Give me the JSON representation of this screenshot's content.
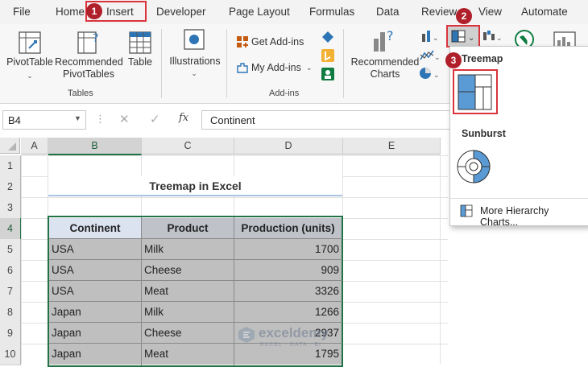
{
  "menu": {
    "tabs": [
      "File",
      "Home",
      "Insert",
      "Developer",
      "Page Layout",
      "Formulas",
      "Data",
      "Review",
      "View",
      "Automate"
    ]
  },
  "ribbon": {
    "pivot_table": "PivotTable",
    "recommended_pivot_1": "Recommended",
    "recommended_pivot_2": "PivotTables",
    "table": "Table",
    "group_tables": "Tables",
    "illustrations": "Illustrations",
    "get_addins": "Get Add-ins",
    "my_addins": "My Add-ins",
    "group_addins": "Add-ins",
    "recommended_charts_1": "Recommended",
    "recommended_charts_2": "Charts"
  },
  "formula_bar": {
    "name_box": "B4",
    "fx": "fx",
    "content": "Continent"
  },
  "grid": {
    "columns": [
      "A",
      "B",
      "C",
      "D",
      "E"
    ],
    "rows": [
      "1",
      "2",
      "3",
      "4",
      "5",
      "6",
      "7",
      "8",
      "9",
      "10"
    ],
    "title": "Treemap in Excel",
    "headers": [
      "Continent",
      "Product",
      "Production (units)"
    ],
    "data": [
      [
        "USA",
        "Milk",
        "1700"
      ],
      [
        "USA",
        "Cheese",
        "909"
      ],
      [
        "USA",
        "Meat",
        "3326"
      ],
      [
        "Japan",
        "Milk",
        "1266"
      ],
      [
        "Japan",
        "Cheese",
        "2937"
      ],
      [
        "Japan",
        "Meat",
        "1795"
      ]
    ]
  },
  "dropdown": {
    "treemap_title": "Treemap",
    "sunburst_title": "Sunburst",
    "more_link": "More Hierarchy Charts..."
  },
  "steps": [
    "1",
    "2",
    "3"
  ],
  "watermark": {
    "brand": "exceldemy",
    "tagline": "EXCEL · DATA · BI"
  },
  "colors": {
    "excel_green": "#217346",
    "highlight_red": "#d9343c",
    "badge_red": "#b0202a",
    "treemap_blue": "#5b9bd5",
    "header_blue": "#dbe3f1"
  }
}
